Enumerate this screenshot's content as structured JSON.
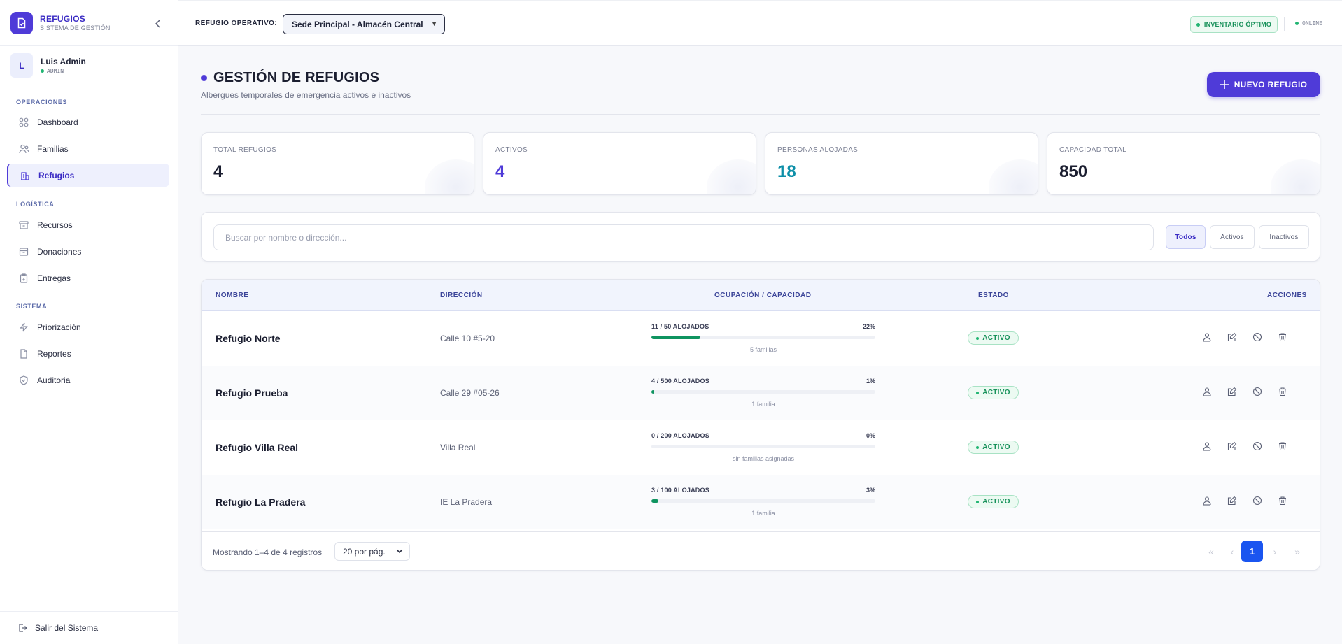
{
  "brand": {
    "name": "REFUGIOS",
    "subtitle": "SISTEMA DE GESTIÓN"
  },
  "user": {
    "initial": "L",
    "name": "Luis Admin",
    "role": "ADMIN"
  },
  "sidebar": {
    "sections": [
      {
        "label": "OPERACIONES"
      },
      {
        "label": "LOGÍSTICA"
      },
      {
        "label": "SISTEMA"
      }
    ],
    "items": [
      {
        "label": "Dashboard",
        "icon": "grid-icon"
      },
      {
        "label": "Familias",
        "icon": "users-icon"
      },
      {
        "label": "Refugios",
        "icon": "building-icon",
        "active": true
      },
      {
        "label": "Recursos",
        "icon": "archive-icon"
      },
      {
        "label": "Donaciones",
        "icon": "box-icon"
      },
      {
        "label": "Entregas",
        "icon": "clipboard-icon"
      },
      {
        "label": "Priorización",
        "icon": "bolt-icon"
      },
      {
        "label": "Reportes",
        "icon": "document-icon"
      },
      {
        "label": "Auditoria",
        "icon": "shield-icon"
      }
    ],
    "logout": "Salir del Sistema"
  },
  "topbar": {
    "label": "REFUGIO OPERATIVO:",
    "selected_refugio": "Sede Principal - Almacén Central",
    "inventory_badge": "INVENTARIO ÓPTIMO",
    "connection": "ONLINE"
  },
  "page": {
    "title": "GESTIÓN DE REFUGIOS",
    "subtitle": "Albergues temporales de emergencia activos e inactivos",
    "new_button": "NUEVO REFUGIO"
  },
  "stats": [
    {
      "label": "TOTAL REFUGIOS",
      "value": "4",
      "color": "#1b1e30"
    },
    {
      "label": "ACTIVOS",
      "value": "4",
      "color": "#4f3bd8"
    },
    {
      "label": "PERSONAS ALOJADAS",
      "value": "18",
      "color": "#0d8fa8"
    },
    {
      "label": "CAPACIDAD TOTAL",
      "value": "850",
      "color": "#1b1e30"
    }
  ],
  "filter": {
    "search_placeholder": "Buscar por nombre o dirección...",
    "search_value": "",
    "buttons": [
      {
        "label": "Todos",
        "active": true
      },
      {
        "label": "Activos",
        "active": false
      },
      {
        "label": "Inactivos",
        "active": false
      }
    ]
  },
  "table": {
    "headers": [
      "NOMBRE",
      "DIRECCIÓN",
      "OCUPACIÓN / CAPACIDAD",
      "ESTADO",
      "ACCIONES"
    ],
    "rows": [
      {
        "name": "Refugio Norte",
        "address": "Calle 10 #5-20",
        "occupancy": "11 / 50 ALOJADOS",
        "percent_label": "22%",
        "percent": 22,
        "families": "5 familias",
        "status": "ACTIVO"
      },
      {
        "name": "Refugio Prueba",
        "address": "Calle 29 #05-26",
        "occupancy": "4 / 500 ALOJADOS",
        "percent_label": "1%",
        "percent": 1,
        "families": "1 familia",
        "status": "ACTIVO"
      },
      {
        "name": "Refugio Villa Real",
        "address": "Villa Real",
        "occupancy": "0 / 200 ALOJADOS",
        "percent_label": "0%",
        "percent": 0,
        "families": "sin familias asignadas",
        "status": "ACTIVO"
      },
      {
        "name": "Refugio La Pradera",
        "address": "IE La Pradera",
        "occupancy": "3 / 100 ALOJADOS",
        "percent_label": "3%",
        "percent": 3,
        "families": "1 familia",
        "status": "ACTIVO"
      }
    ],
    "footer_text": "Mostrando 1–4 de 4 registros",
    "per_page": "20 por pág.",
    "current_page": "1"
  },
  "colors": {
    "accent": "#4f3bd8",
    "success": "#17915a",
    "pagination": "#1a55f0"
  }
}
